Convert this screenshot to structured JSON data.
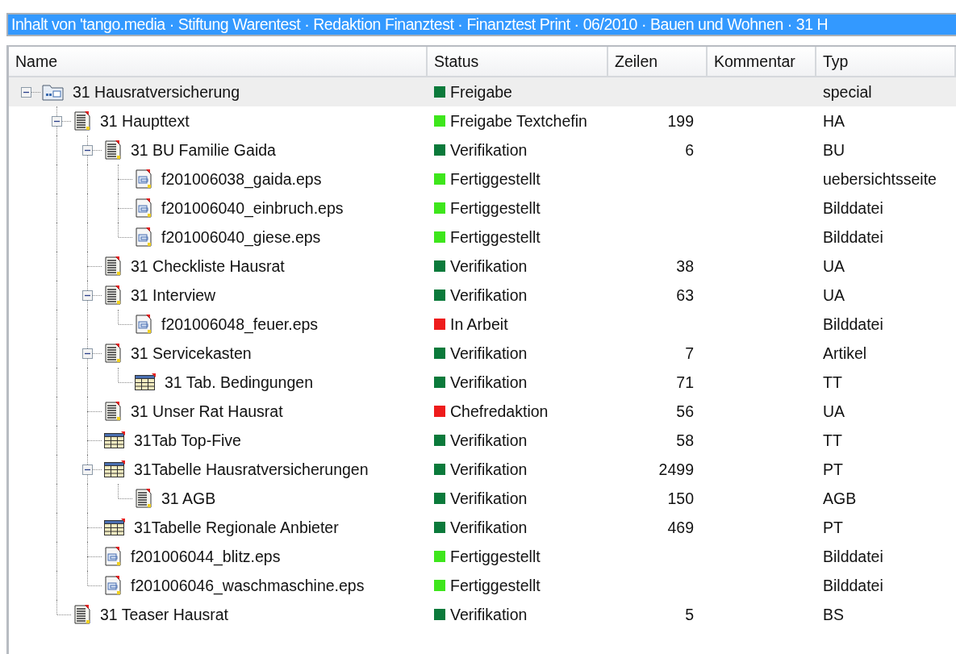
{
  "title_bar": {
    "text": "Inhalt von 'tango.media · Stiftung Warentest · Redaktion Finanztest · Finanztest Print · 06/2010 · Bauen und Wohnen · 31 H"
  },
  "columns": [
    "Name",
    "Status",
    "Zeilen",
    "Kommentar",
    "Typ"
  ],
  "rows": [
    {
      "kind": "folder",
      "name": "31 Hausratversicherung",
      "status": "Freigabe",
      "color": "#0b7a3b",
      "type": "special",
      "selected": true,
      "expanded": true,
      "children": [
        {
          "kind": "text",
          "name": "31 Haupttext",
          "status": "Freigabe Textchefin",
          "color": "#3ee61c",
          "lines": "199",
          "type": "HA",
          "selected": false,
          "expanded": true,
          "children": [
            {
              "kind": "text",
              "name": "31 BU Familie Gaida",
              "status": "Verifikation",
              "color": "#0b7a3b",
              "lines": "6",
              "type": "BU",
              "selected": false,
              "expanded": true,
              "children": [
                {
                  "kind": "image",
                  "name": "f201006038_gaida.eps",
                  "status": "Fertiggestellt",
                  "color": "#3ee61c",
                  "type": "uebersichtsseite",
                  "selected": false
                },
                {
                  "kind": "image",
                  "name": "f201006040_einbruch.eps",
                  "status": "Fertiggestellt",
                  "color": "#3ee61c",
                  "type": "Bilddatei",
                  "selected": false
                },
                {
                  "kind": "image",
                  "name": "f201006040_giese.eps",
                  "status": "Fertiggestellt",
                  "color": "#3ee61c",
                  "type": "Bilddatei",
                  "selected": false
                }
              ]
            },
            {
              "kind": "text",
              "name": "31 Checkliste Hausrat",
              "status": "Verifikation",
              "color": "#0b7a3b",
              "lines": "38",
              "type": "UA",
              "selected": false
            },
            {
              "kind": "text",
              "name": "31 Interview",
              "status": "Verifikation",
              "color": "#0b7a3b",
              "lines": "63",
              "type": "UA",
              "selected": false,
              "expanded": true,
              "children": [
                {
                  "kind": "image",
                  "name": "f201006048_feuer.eps",
                  "status": "In Arbeit",
                  "color": "#ee1c1c",
                  "type": "Bilddatei",
                  "selected": false
                }
              ]
            },
            {
              "kind": "text",
              "name": "31 Servicekasten",
              "status": "Verifikation",
              "color": "#0b7a3b",
              "lines": "7",
              "type": "Artikel",
              "selected": false,
              "expanded": true,
              "children": [
                {
                  "kind": "table",
                  "name": "31 Tab. Bedingungen",
                  "status": "Verifikation",
                  "color": "#0b7a3b",
                  "lines": "71",
                  "type": "TT",
                  "selected": false
                }
              ]
            },
            {
              "kind": "text",
              "name": "31 Unser Rat Hausrat",
              "status": "Chefredaktion",
              "color": "#ee1c1c",
              "lines": "56",
              "type": "UA",
              "selected": false
            },
            {
              "kind": "table",
              "name": "31Tab Top-Five",
              "status": "Verifikation",
              "color": "#0b7a3b",
              "lines": "58",
              "type": "TT",
              "selected": false
            },
            {
              "kind": "table",
              "name": "31Tabelle Hausratversicherungen",
              "status": "Verifikation",
              "color": "#0b7a3b",
              "lines": "2499",
              "type": "PT",
              "selected": false,
              "expanded": true,
              "children": [
                {
                  "kind": "text",
                  "name": "31 AGB",
                  "status": "Verifikation",
                  "color": "#0b7a3b",
                  "lines": "150",
                  "type": "AGB",
                  "selected": false
                }
              ]
            },
            {
              "kind": "table",
              "name": "31Tabelle Regionale Anbieter",
              "status": "Verifikation",
              "color": "#0b7a3b",
              "lines": "469",
              "type": "PT",
              "selected": false
            },
            {
              "kind": "image",
              "name": "f201006044_blitz.eps",
              "status": "Fertiggestellt",
              "color": "#3ee61c",
              "type": "Bilddatei",
              "selected": false
            },
            {
              "kind": "image",
              "name": "f201006046_waschmaschine.eps",
              "status": "Fertiggestellt",
              "color": "#3ee61c",
              "type": "Bilddatei",
              "selected": false
            }
          ]
        },
        {
          "kind": "text",
          "name": "31 Teaser Hausrat",
          "status": "Verifikation",
          "color": "#0b7a3b",
          "lines": "5",
          "type": "BS",
          "selected": false
        }
      ]
    }
  ]
}
